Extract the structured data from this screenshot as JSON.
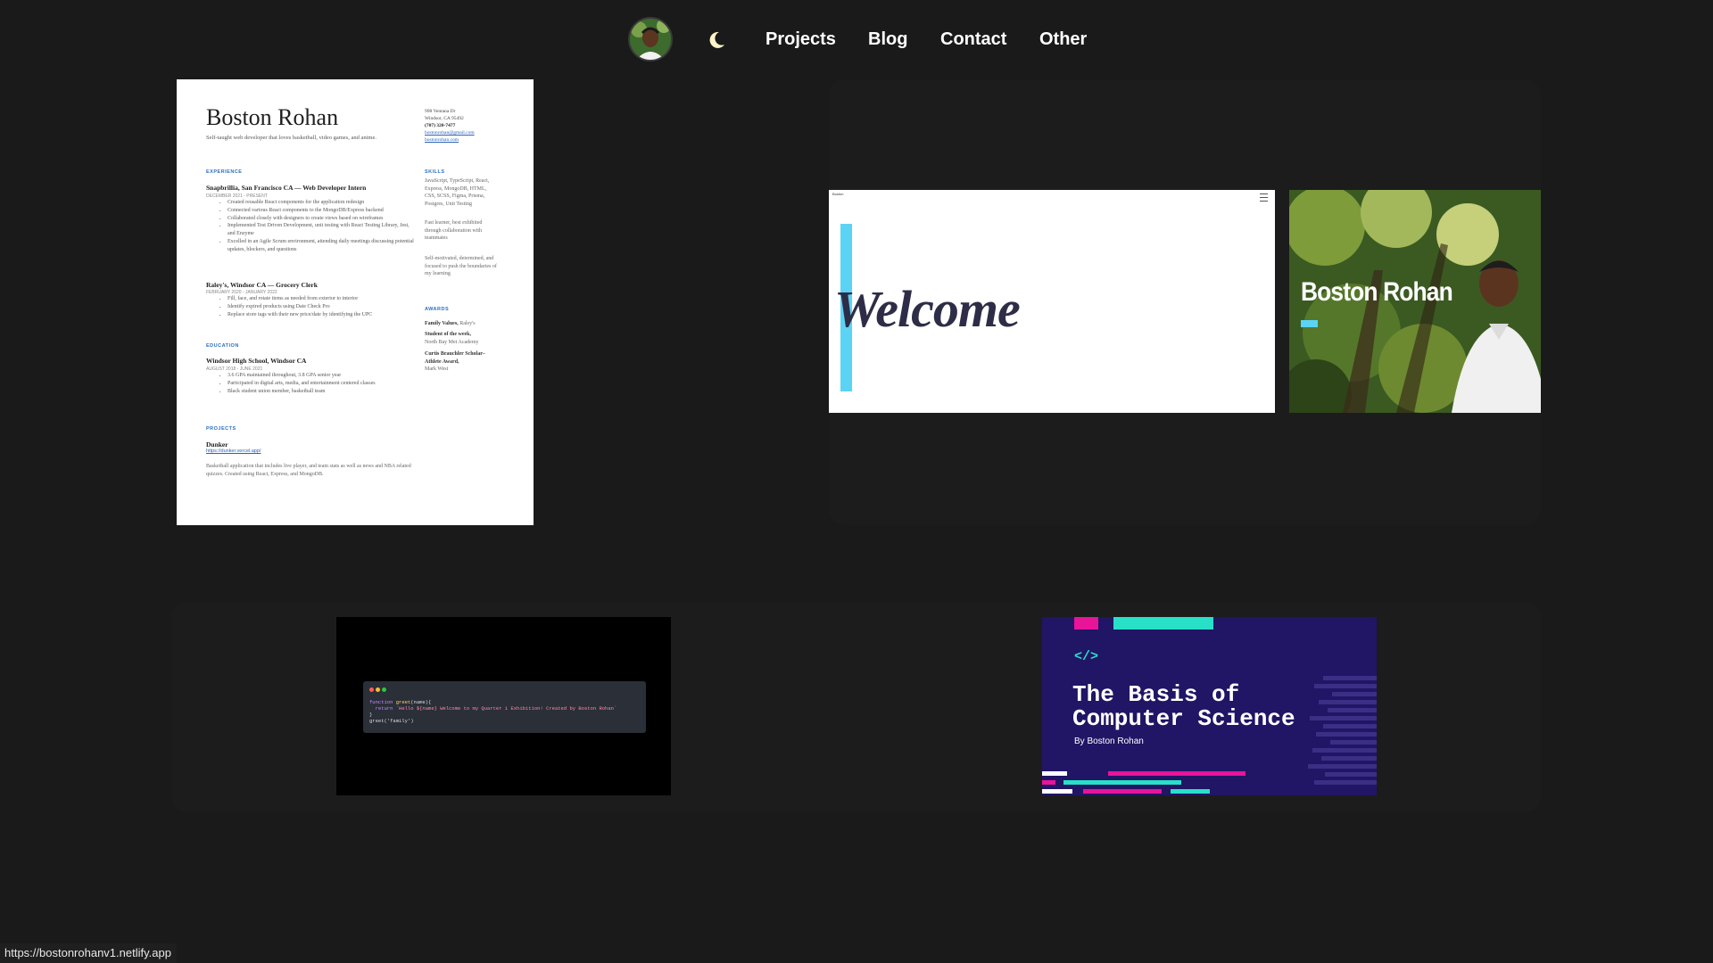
{
  "nav": {
    "avatar_icon": "profile-photo",
    "theme_icon": "moon-icon",
    "links": [
      "Projects",
      "Blog",
      "Contact",
      "Other"
    ]
  },
  "resume": {
    "name": "Boston Rohan",
    "tagline": "Self-taught web developer that loves basketball, video games, and anime.",
    "contact": [
      "998 Ventana Dr",
      "Windsor, CA 95492",
      "(707) 320-7477",
      "bostonrohan@gmail.com",
      "bostonrohan.com"
    ],
    "experience_title": "EXPERIENCE",
    "job1": {
      "title": "Snapbrillia, San Francisco CA — Web Developer Intern",
      "date": "DECEMBER 2021 - PRESENT",
      "bullets": [
        "Created reusable React components for the application redesign",
        "Connected various React components to the MongoDB/Express backend",
        "Collaborated closely with designers to create views based on wireframes",
        "Implemented Test Driven Development, unit testing with React Testing Library, Jest, and Enzyme",
        "Excelled in an Agile Scrum environment, attending daily meetings discussing potential updates, blockers, and questions"
      ]
    },
    "job2": {
      "title": "Raley's, Windsor CA — Grocery Clerk",
      "date": "FEBRUARY 2020 - JANUARY 2022",
      "bullets": [
        "Fill, face, and rotate items as needed from exterior to interior",
        "Identify expired products using Date Check Pro",
        "Replace store tags with their new price/date by identifying the UPC"
      ]
    },
    "education_title": "EDUCATION",
    "school": {
      "title": "Windsor High School, Windsor CA",
      "date": "AUGUST 2018 - JUNE 2021",
      "bullets": [
        "3.6 GPA maintained throughout, 3.8 GPA senior year",
        "Participated in digital arts, media, and entertainment centered classes",
        "Black student union member, basketball team"
      ]
    },
    "projects_title": "PROJECTS",
    "project": {
      "name": "Dunker",
      "link": "https://dunker.vercel.app/",
      "desc": "Basketball application that includes live player, and team stats as well as news and NBA related quizzes. Created using React, Express, and MongoDB."
    },
    "skills_title": "SKILLS",
    "skills": [
      "JavaScript, TypeScript, React, Express, MongoDB, HTML, CSS, SCSS, Figma, Prisma, Postgres, Unit Testing",
      "Fast learner, best exhibited through collaboration with teammates",
      "Self-motivated, determined, and focused to push the boundaries of my learning"
    ],
    "awards_title": "AWARDS",
    "awards": [
      {
        "name": "Family Values,",
        "from": "Raley's"
      },
      {
        "name": "Student of the week,",
        "from": "North Bay Met Academy"
      },
      {
        "name": "Curtis Brauchler Scholar–Athlete Award,",
        "from": "Mark West"
      }
    ]
  },
  "welcome_shot": {
    "word": "Welcome",
    "brand": "Boston"
  },
  "photo_shot": {
    "title": "Boston Rohan"
  },
  "code_shot": {
    "line1_kw": "function ",
    "line1_fn": "greet",
    "line1_rest": "(name){",
    "line2_kw": "  return ",
    "line2_str": "`Hello ${name} Welcome to my Quarter 1 Exhibition! Created by Boston Rohan`",
    "line3": "}",
    "line4": "greet('family')"
  },
  "cs_shot": {
    "icon": "code-brackets-icon",
    "title_line1": "The Basis of",
    "title_line2": "Computer Science",
    "byline": "By Boston Rohan",
    "colors": {
      "bg": "#211565",
      "teal": "#28e0c8",
      "pink": "#e8149a"
    }
  },
  "status_url": "https://bostonrohanv1.netlify.app"
}
